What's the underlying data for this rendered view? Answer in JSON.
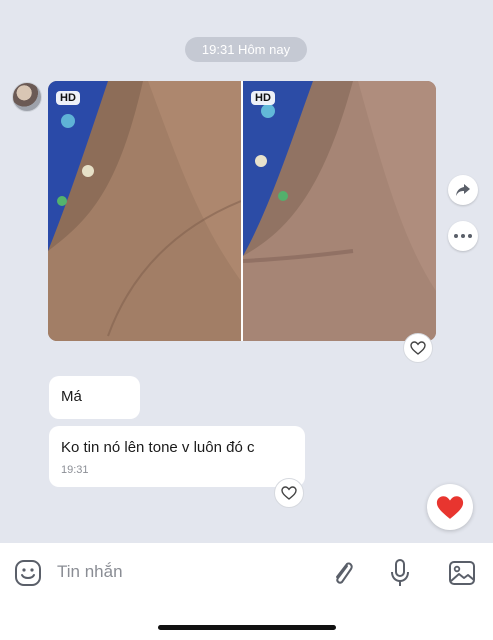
{
  "timestamp_pill": "19:31 Hôm nay",
  "photos": [
    {
      "badge": "HD",
      "icon": "photo-thumbnail"
    },
    {
      "badge": "HD",
      "icon": "photo-thumbnail"
    }
  ],
  "messages": [
    {
      "text": "Má"
    },
    {
      "text": "Ko tin nó lên tone v luôn đó c",
      "time": "19:31"
    }
  ],
  "input": {
    "placeholder": "Tin nhắn"
  },
  "icons": {
    "share": "share-arrow-icon",
    "more": "more-dots-icon",
    "like": "heart-outline-icon",
    "quick_reaction": "red-heart-icon",
    "sticker": "smiley-icon",
    "attach": "paperclip-icon",
    "mic": "microphone-icon",
    "gallery": "image-icon"
  },
  "colors": {
    "background": "#e3e6ee",
    "heart": "#e8352f",
    "icon": "#5a5f69"
  }
}
